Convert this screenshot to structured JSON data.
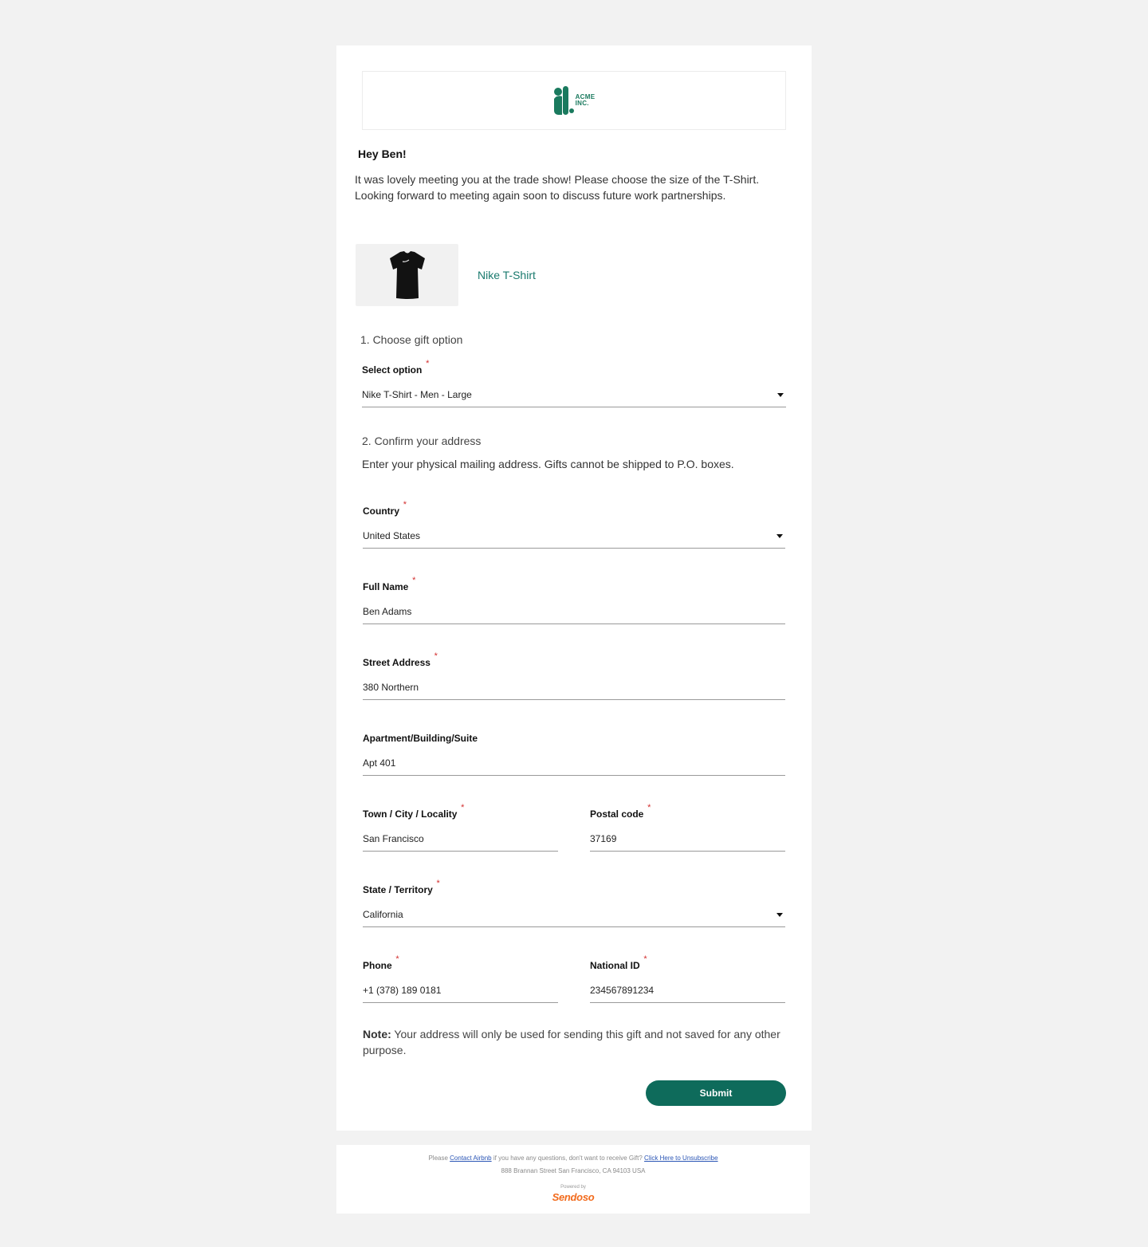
{
  "header": {
    "logo_text_line1": "ACME",
    "logo_text_line2": "INC."
  },
  "greeting": "Hey Ben!",
  "message": "It was lovely meeting you at the trade show! Please choose the size of the T-Shirt. Looking forward to meeting again soon to discuss future work partnerships.",
  "product": {
    "name": "Nike T-Shirt",
    "image_icon": "tshirt-icon"
  },
  "section1": {
    "title": "1. Choose gift option"
  },
  "gift_option": {
    "label": "Select option",
    "value": "Nike T-Shirt - Men - Large"
  },
  "section2": {
    "title": "2. Confirm your address",
    "description": "Enter your physical mailing address. Gifts cannot be shipped to P.O. boxes."
  },
  "fields": {
    "country": {
      "label": "Country",
      "value": "United States"
    },
    "full_name": {
      "label": "Full Name",
      "value": "Ben Adams"
    },
    "street": {
      "label": "Street Address",
      "value": "380 Northern"
    },
    "apartment": {
      "label": "Apartment/Building/Suite",
      "value": "Apt 401"
    },
    "city": {
      "label": "Town / City / Locality",
      "value": "San Francisco"
    },
    "postal": {
      "label": "Postal code",
      "value": "37169"
    },
    "state": {
      "label": "State / Territory",
      "value": "California"
    },
    "phone": {
      "label": "Phone",
      "value": "+1 (378) 189 0181"
    },
    "national_id": {
      "label": "National ID",
      "value": "234567891234"
    }
  },
  "required_mark": "*",
  "note": {
    "bold": "Note:",
    "text": " Your address will only be used for sending this gift and not saved for any other purpose."
  },
  "submit_label": "Submit",
  "footer": {
    "pre": "Please ",
    "contact_link": "Contact Airbnb",
    "mid": " if you have any questions, don't want to receive Gift? ",
    "unsubscribe_link": "Click Here to Unsubscribe",
    "address": "888 Brannan Street San Francisco, CA 94103 USA",
    "powered_by": "Powered by",
    "brand": "Sendoso"
  },
  "colors": {
    "accent": "#0e6b5b",
    "link": "#1a7a6e",
    "required": "#d32f2f",
    "brand": "#f26b1d",
    "background": "#f2f2f2"
  }
}
